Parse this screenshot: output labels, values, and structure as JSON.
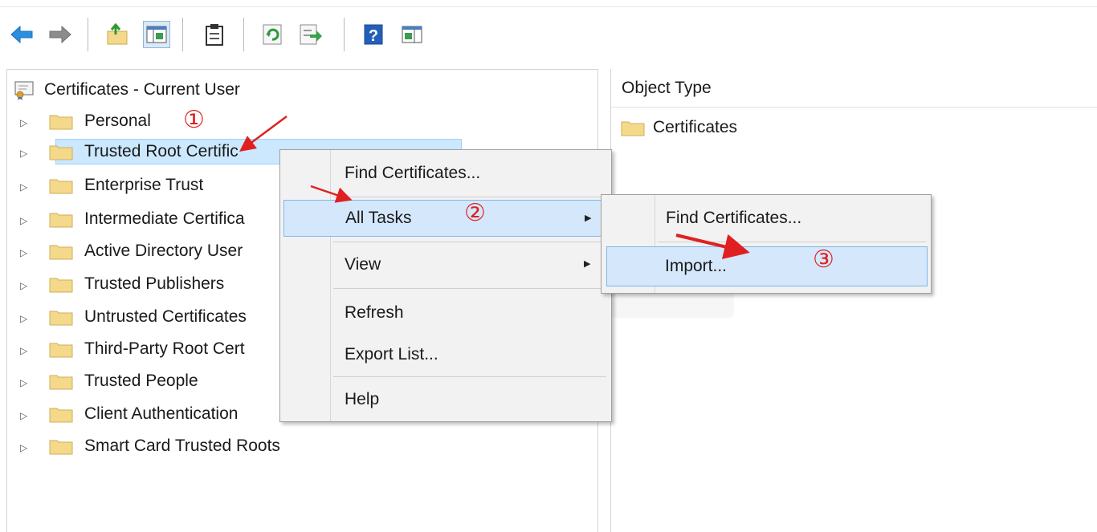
{
  "toolbar": {
    "buttons": [
      {
        "name": "back-icon"
      },
      {
        "name": "forward-icon"
      },
      {
        "name": "up-folder-icon"
      },
      {
        "name": "show-hide-console-tree-icon"
      },
      {
        "name": "clipboard-icon"
      },
      {
        "name": "refresh-icon"
      },
      {
        "name": "export-list-icon"
      },
      {
        "name": "help-icon"
      },
      {
        "name": "show-action-pane-icon"
      }
    ]
  },
  "tree": {
    "root": "Certificates - Current User",
    "nodes": [
      "Personal",
      "Trusted Root Certification Authorities",
      "Enterprise Trust",
      "Intermediate Certification Authorities",
      "Active Directory User Object",
      "Trusted Publishers",
      "Untrusted Certificates",
      "Third-Party Root Certification Authorities",
      "Trusted People",
      "Client Authentication Issuers",
      "Smart Card Trusted Roots"
    ],
    "visible_labels": [
      "Personal",
      "Trusted Root Certific",
      "Enterprise Trust",
      "Intermediate Certifica",
      "Active Directory User",
      "Trusted Publishers",
      "Untrusted Certificates",
      "Third-Party Root Cert",
      "Trusted People",
      "Client Authentication",
      "Smart Card Trusted Roots"
    ]
  },
  "list": {
    "column_header": "Object Type",
    "items": [
      "Certificates"
    ]
  },
  "context_menu": {
    "items": [
      {
        "label": "Find Certificates..."
      },
      {
        "label": "All Tasks"
      },
      {
        "label": "View"
      },
      {
        "label": "Refresh"
      },
      {
        "label": "Export List..."
      },
      {
        "label": "Help"
      }
    ]
  },
  "submenu": {
    "items": [
      {
        "label": "Find Certificates..."
      },
      {
        "label": "Import..."
      }
    ]
  },
  "annotations": {
    "step1": "①",
    "step2": "②",
    "step3": "③",
    "color": "#e02020"
  },
  "colors": {
    "selection": "#cce8ff",
    "menu_highlight": "#d5e8fb",
    "folder": "#f4d98b"
  }
}
